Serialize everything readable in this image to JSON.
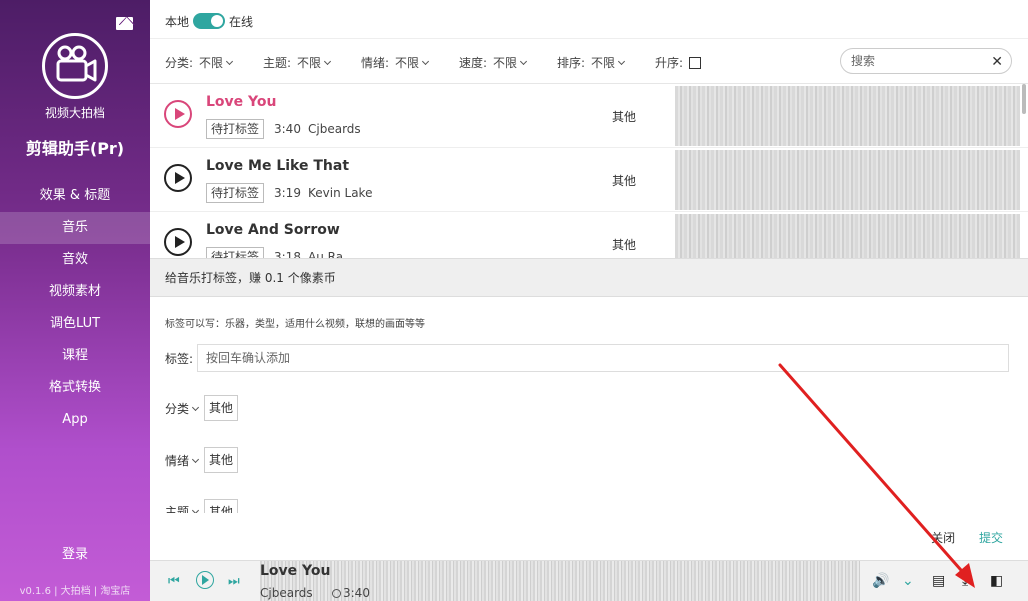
{
  "sidebar": {
    "brand_small": "视频大拍档",
    "brand_big": "剪辑助手(Pr)",
    "items": [
      {
        "label": "效果 & 标题"
      },
      {
        "label": "音乐"
      },
      {
        "label": "音效"
      },
      {
        "label": "视频素材"
      },
      {
        "label": "调色LUT"
      },
      {
        "label": "课程"
      },
      {
        "label": "格式转换"
      },
      {
        "label": "App"
      }
    ],
    "active_index": 1,
    "login": "登录",
    "footer": "v0.1.6 | 大拍档 | 淘宝店"
  },
  "topbar": {
    "local_label": "本地",
    "online_label": "在线",
    "online_enabled": true
  },
  "filters": {
    "items": [
      {
        "label": "分类:",
        "value": "不限"
      },
      {
        "label": "主题:",
        "value": "不限"
      },
      {
        "label": "情绪:",
        "value": "不限"
      },
      {
        "label": "速度:",
        "value": "不限"
      },
      {
        "label": "排序:",
        "value": "不限"
      }
    ],
    "ascending_label": "升序:",
    "ascending_checked": false,
    "search_placeholder": "搜索"
  },
  "songs": [
    {
      "title": "Love You",
      "tag_button": "待打标签",
      "duration": "3:40",
      "artist": "Cjbeards",
      "category": "其他",
      "active": true
    },
    {
      "title": "Love Me Like That",
      "tag_button": "待打标签",
      "duration": "3:19",
      "artist": "Kevin Lake",
      "category": "其他",
      "active": false
    },
    {
      "title": "Love And Sorrow",
      "tag_button": "待打标签",
      "duration": "3:18",
      "artist": "Au Ra",
      "category": "其他",
      "active": false
    }
  ],
  "tag_panel": {
    "header": "给音乐打标签，赚 0.1 个像素币",
    "hint": "标签可以写：乐器，类型，适用什么视频，联想的画面等等",
    "label_field_label": "标签:",
    "label_placeholder": "按回车确认添加",
    "props": [
      {
        "label": "分类",
        "value": "其他"
      },
      {
        "label": "情绪",
        "value": "其他"
      },
      {
        "label": "主题",
        "value": "其他"
      }
    ],
    "close": "关闭",
    "submit": "提交"
  },
  "player": {
    "title": "Love You",
    "artist": "Cjbeards",
    "duration": "3:40"
  },
  "colors": {
    "accent": "#2fa6a0",
    "active_song": "#d9467a",
    "sidebar_top": "#4d1d66",
    "sidebar_bottom": "#c35cd6",
    "arrow": "#e02020"
  }
}
